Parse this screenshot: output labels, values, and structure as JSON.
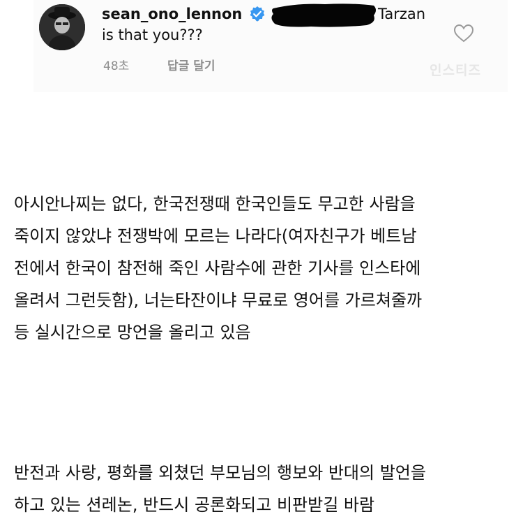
{
  "comment": {
    "username": "sean_ono_lennon",
    "mention_tail": "Tarzan",
    "line2": "is that you???",
    "time": "48초",
    "reply_label": "답글 달기",
    "icons": [
      "verified-badge-icon",
      "heart-icon"
    ],
    "verified_color": "#3897f0",
    "watermark": "인스티즈"
  },
  "body": {
    "paragraph1": [
      "아시안나찌는 없다, 한국전쟁때 한국인들도 무고한 사람을",
      "죽이지 않았냐 전쟁박에 모르는 나라다(여자친구가 베트남",
      "전에서 한국이 참전해 죽인 사람수에 관한 기사를 인스타에",
      "올려서 그런듯함), 너는타잔이냐 무료로 영어를 가르쳐줄까",
      "등 실시간으로 망언을 올리고 있음"
    ],
    "paragraph2": [
      "반전과 사랑, 평화를 외쳤던 부모님의 행보와 반대의 발언을",
      "하고 있는 션레논, 반드시 공론화되고 비판받길 바람"
    ]
  }
}
